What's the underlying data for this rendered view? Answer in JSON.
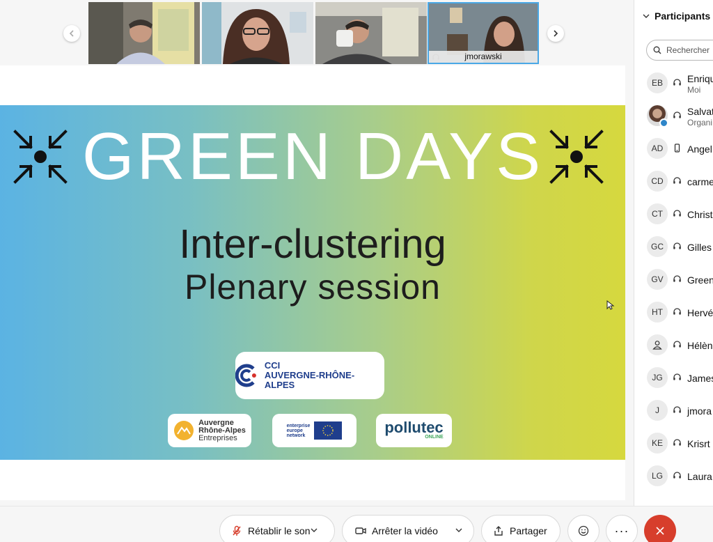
{
  "video_strip": {
    "tiles": [
      {
        "name": ""
      },
      {
        "name": ""
      },
      {
        "name": ""
      },
      {
        "name": "jmorawski"
      }
    ]
  },
  "slide": {
    "title": "GREEN DAYS",
    "subtitle": "Inter-clustering",
    "session": "Plenary session",
    "cci_line1": "CCI",
    "cci_line2": "AUVERGNE-RHÔNE-ALPES",
    "ara_line1": "Auvergne",
    "ara_line2": "Rhône-Alpes",
    "ara_line3": "Entreprises",
    "een_line1": "enterprise",
    "een_line2": "europe",
    "een_line3": "network",
    "pollutec_name": "pollutec",
    "pollutec_sub": "ONLINE",
    "colors": {
      "gradient_left": "#5bb3e3",
      "gradient_right": "#d6d83e"
    }
  },
  "panel": {
    "title": "Participants",
    "search_placeholder": "Rechercher",
    "participants": [
      {
        "initials": "EB",
        "name": "Enrique",
        "subtitle": "Moi",
        "icon": "headset-icon"
      },
      {
        "initials": "",
        "name": "Salvat",
        "subtitle": "Organi",
        "icon": "headset-icon",
        "photo": true
      },
      {
        "initials": "AD",
        "name": "Angel",
        "subtitle": "",
        "icon": "phone-icon"
      },
      {
        "initials": "CD",
        "name": "carme",
        "subtitle": "",
        "icon": "headset-icon"
      },
      {
        "initials": "CT",
        "name": "Christ",
        "subtitle": "",
        "icon": "headset-icon"
      },
      {
        "initials": "GC",
        "name": "Gilles",
        "subtitle": "",
        "icon": "headset-icon"
      },
      {
        "initials": "GV",
        "name": "Green",
        "subtitle": "",
        "icon": "headset-icon"
      },
      {
        "initials": "HT",
        "name": "Hervé",
        "subtitle": "",
        "icon": "headset-icon"
      },
      {
        "initials": "",
        "name": "Hélèn",
        "subtitle": "",
        "icon": "headset-icon",
        "person": true
      },
      {
        "initials": "JG",
        "name": "James",
        "subtitle": "",
        "icon": "headset-icon"
      },
      {
        "initials": "J",
        "name": "jmora",
        "subtitle": "",
        "icon": "headset-icon"
      },
      {
        "initials": "KE",
        "name": "Krisrt",
        "subtitle": "",
        "icon": "headset-icon"
      },
      {
        "initials": "LG",
        "name": "Laura",
        "subtitle": "",
        "icon": "headset-icon"
      }
    ]
  },
  "controls": {
    "unmute_label": "Rétablir le son",
    "video_label": "Arrêter la vidéo",
    "share_label": "Partager",
    "more_label": "···",
    "leave_color": "#d73e2c"
  }
}
